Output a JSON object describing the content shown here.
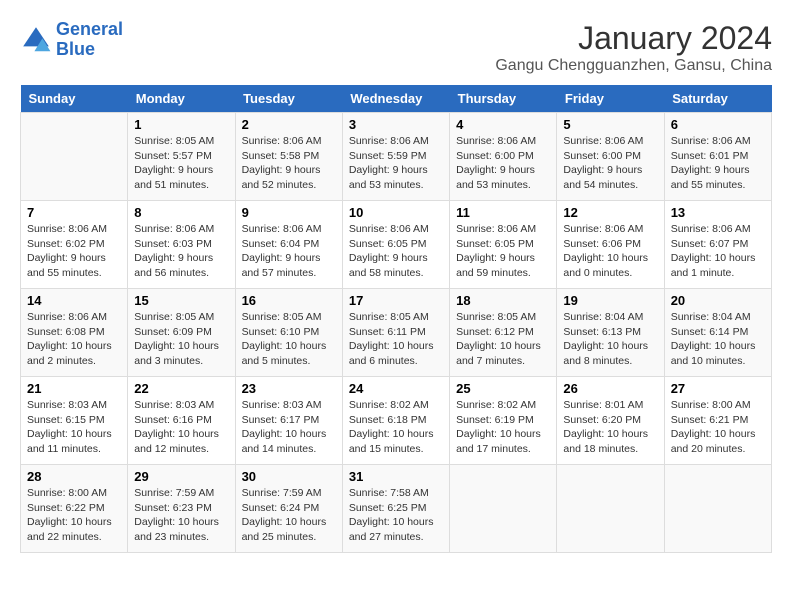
{
  "logo": {
    "line1": "General",
    "line2": "Blue"
  },
  "title": "January 2024",
  "location": "Gangu Chengguanzhen, Gansu, China",
  "headers": [
    "Sunday",
    "Monday",
    "Tuesday",
    "Wednesday",
    "Thursday",
    "Friday",
    "Saturday"
  ],
  "weeks": [
    [
      {
        "day": "",
        "info": ""
      },
      {
        "day": "1",
        "info": "Sunrise: 8:05 AM\nSunset: 5:57 PM\nDaylight: 9 hours\nand 51 minutes."
      },
      {
        "day": "2",
        "info": "Sunrise: 8:06 AM\nSunset: 5:58 PM\nDaylight: 9 hours\nand 52 minutes."
      },
      {
        "day": "3",
        "info": "Sunrise: 8:06 AM\nSunset: 5:59 PM\nDaylight: 9 hours\nand 53 minutes."
      },
      {
        "day": "4",
        "info": "Sunrise: 8:06 AM\nSunset: 6:00 PM\nDaylight: 9 hours\nand 53 minutes."
      },
      {
        "day": "5",
        "info": "Sunrise: 8:06 AM\nSunset: 6:00 PM\nDaylight: 9 hours\nand 54 minutes."
      },
      {
        "day": "6",
        "info": "Sunrise: 8:06 AM\nSunset: 6:01 PM\nDaylight: 9 hours\nand 55 minutes."
      }
    ],
    [
      {
        "day": "7",
        "info": "Sunrise: 8:06 AM\nSunset: 6:02 PM\nDaylight: 9 hours\nand 55 minutes."
      },
      {
        "day": "8",
        "info": "Sunrise: 8:06 AM\nSunset: 6:03 PM\nDaylight: 9 hours\nand 56 minutes."
      },
      {
        "day": "9",
        "info": "Sunrise: 8:06 AM\nSunset: 6:04 PM\nDaylight: 9 hours\nand 57 minutes."
      },
      {
        "day": "10",
        "info": "Sunrise: 8:06 AM\nSunset: 6:05 PM\nDaylight: 9 hours\nand 58 minutes."
      },
      {
        "day": "11",
        "info": "Sunrise: 8:06 AM\nSunset: 6:05 PM\nDaylight: 9 hours\nand 59 minutes."
      },
      {
        "day": "12",
        "info": "Sunrise: 8:06 AM\nSunset: 6:06 PM\nDaylight: 10 hours\nand 0 minutes."
      },
      {
        "day": "13",
        "info": "Sunrise: 8:06 AM\nSunset: 6:07 PM\nDaylight: 10 hours\nand 1 minute."
      }
    ],
    [
      {
        "day": "14",
        "info": "Sunrise: 8:06 AM\nSunset: 6:08 PM\nDaylight: 10 hours\nand 2 minutes."
      },
      {
        "day": "15",
        "info": "Sunrise: 8:05 AM\nSunset: 6:09 PM\nDaylight: 10 hours\nand 3 minutes."
      },
      {
        "day": "16",
        "info": "Sunrise: 8:05 AM\nSunset: 6:10 PM\nDaylight: 10 hours\nand 5 minutes."
      },
      {
        "day": "17",
        "info": "Sunrise: 8:05 AM\nSunset: 6:11 PM\nDaylight: 10 hours\nand 6 minutes."
      },
      {
        "day": "18",
        "info": "Sunrise: 8:05 AM\nSunset: 6:12 PM\nDaylight: 10 hours\nand 7 minutes."
      },
      {
        "day": "19",
        "info": "Sunrise: 8:04 AM\nSunset: 6:13 PM\nDaylight: 10 hours\nand 8 minutes."
      },
      {
        "day": "20",
        "info": "Sunrise: 8:04 AM\nSunset: 6:14 PM\nDaylight: 10 hours\nand 10 minutes."
      }
    ],
    [
      {
        "day": "21",
        "info": "Sunrise: 8:03 AM\nSunset: 6:15 PM\nDaylight: 10 hours\nand 11 minutes."
      },
      {
        "day": "22",
        "info": "Sunrise: 8:03 AM\nSunset: 6:16 PM\nDaylight: 10 hours\nand 12 minutes."
      },
      {
        "day": "23",
        "info": "Sunrise: 8:03 AM\nSunset: 6:17 PM\nDaylight: 10 hours\nand 14 minutes."
      },
      {
        "day": "24",
        "info": "Sunrise: 8:02 AM\nSunset: 6:18 PM\nDaylight: 10 hours\nand 15 minutes."
      },
      {
        "day": "25",
        "info": "Sunrise: 8:02 AM\nSunset: 6:19 PM\nDaylight: 10 hours\nand 17 minutes."
      },
      {
        "day": "26",
        "info": "Sunrise: 8:01 AM\nSunset: 6:20 PM\nDaylight: 10 hours\nand 18 minutes."
      },
      {
        "day": "27",
        "info": "Sunrise: 8:00 AM\nSunset: 6:21 PM\nDaylight: 10 hours\nand 20 minutes."
      }
    ],
    [
      {
        "day": "28",
        "info": "Sunrise: 8:00 AM\nSunset: 6:22 PM\nDaylight: 10 hours\nand 22 minutes."
      },
      {
        "day": "29",
        "info": "Sunrise: 7:59 AM\nSunset: 6:23 PM\nDaylight: 10 hours\nand 23 minutes."
      },
      {
        "day": "30",
        "info": "Sunrise: 7:59 AM\nSunset: 6:24 PM\nDaylight: 10 hours\nand 25 minutes."
      },
      {
        "day": "31",
        "info": "Sunrise: 7:58 AM\nSunset: 6:25 PM\nDaylight: 10 hours\nand 27 minutes."
      },
      {
        "day": "",
        "info": ""
      },
      {
        "day": "",
        "info": ""
      },
      {
        "day": "",
        "info": ""
      }
    ]
  ]
}
